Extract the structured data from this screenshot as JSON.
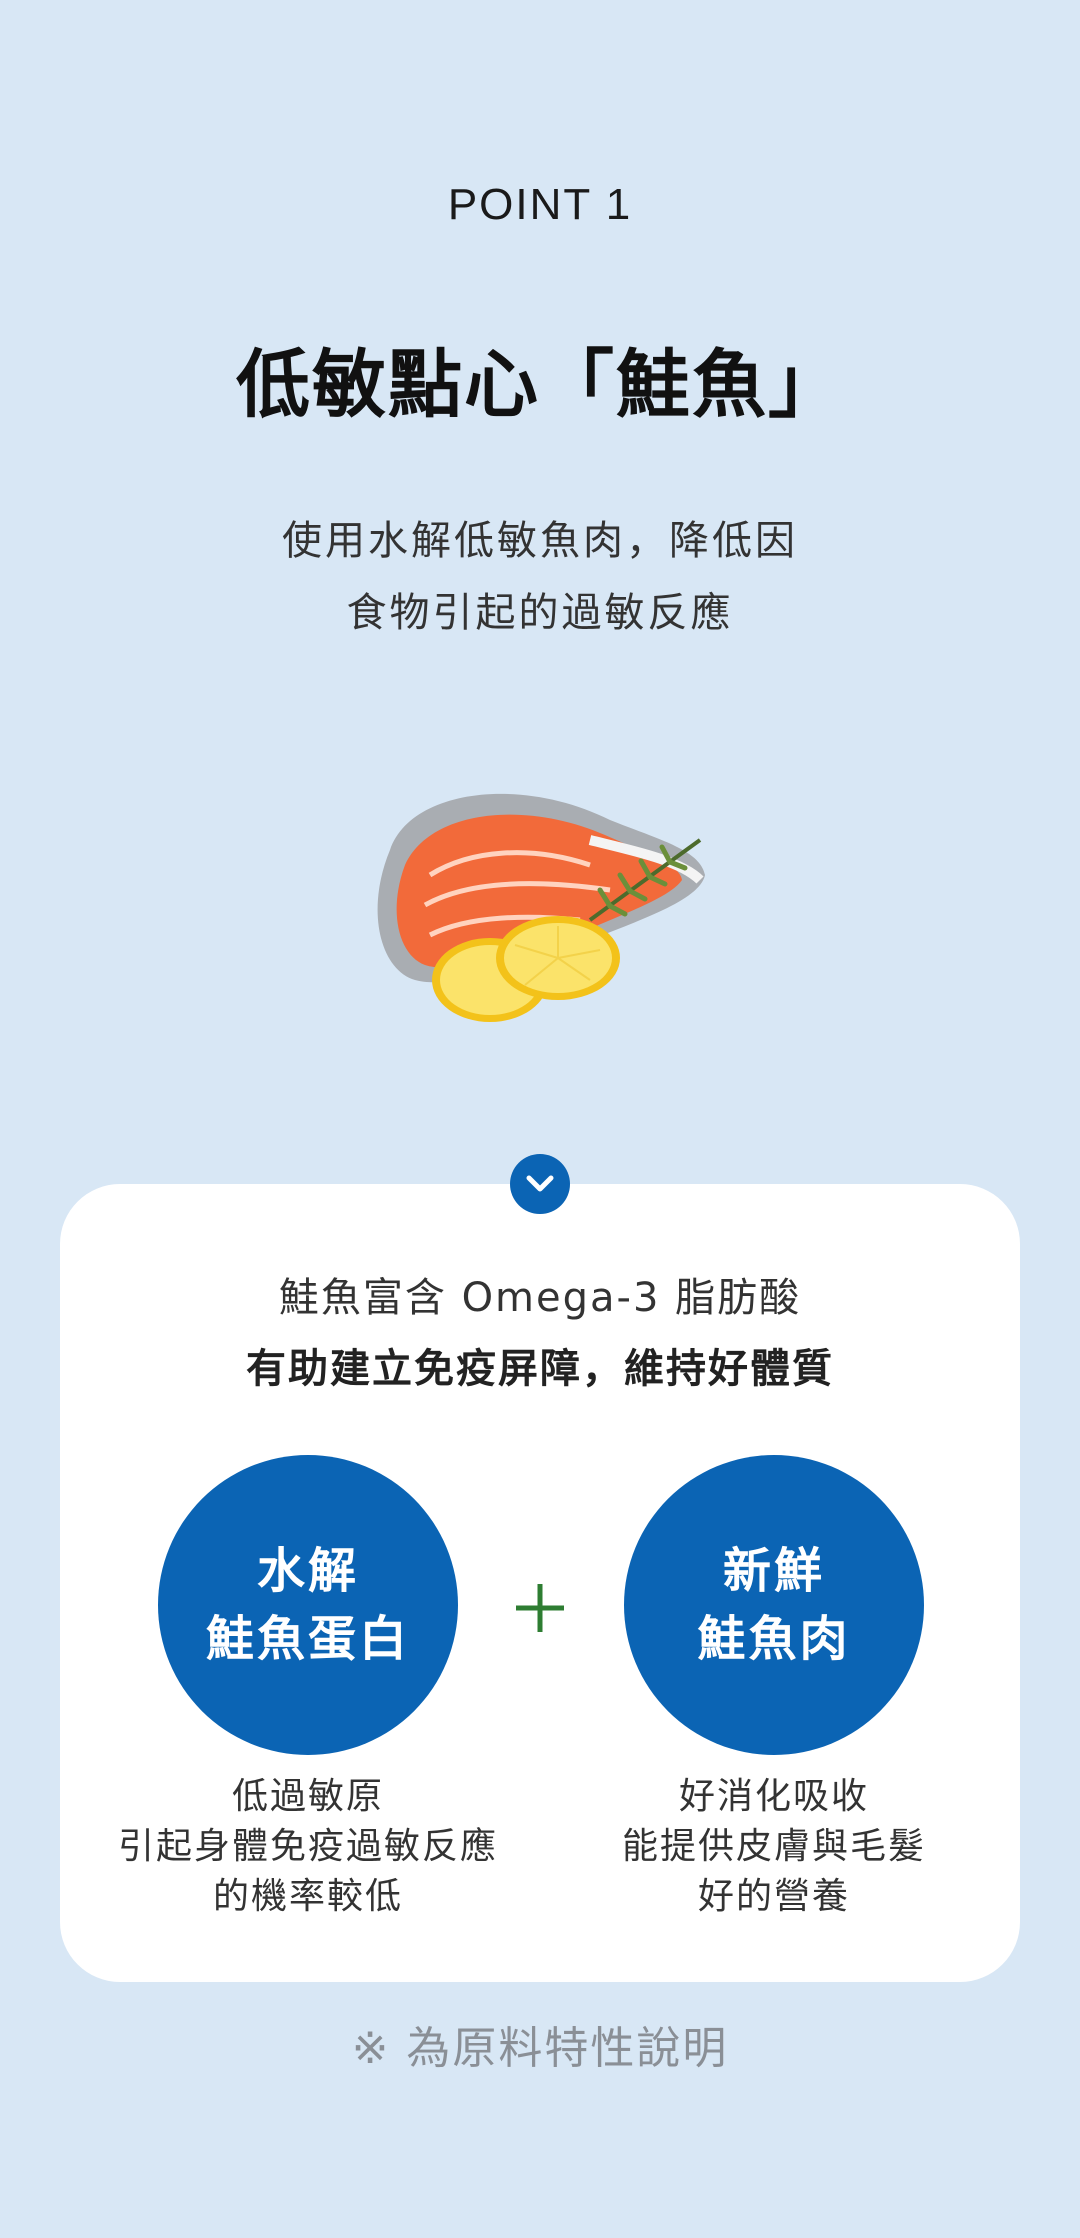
{
  "header": {
    "point_label": "POINT 1",
    "title": "低敏點心「鮭魚」",
    "subtitle_line1": "使用水解低敏魚肉，降低因",
    "subtitle_line2": "食物引起的過敏反應"
  },
  "illustration": {
    "icon": "salmon-steak-with-lemon"
  },
  "card": {
    "line1": "鮭魚富含 Omega-3 脂肪酸",
    "line2": "有助建立免疫屏障，維持好體質",
    "left": {
      "circle_line1": "水解",
      "circle_line2": "鮭魚蛋白",
      "desc_line1": "低過敏原",
      "desc_line2": "引起身體免疫過敏反應",
      "desc_line3": "的機率較低"
    },
    "right": {
      "circle_line1": "新鮮",
      "circle_line2": "鮭魚肉",
      "desc_line1": "好消化吸收",
      "desc_line2": "能提供皮膚與毛髮",
      "desc_line3": "好的營養"
    }
  },
  "footnote": "※ 為原料特性說明",
  "colors": {
    "background": "#d8e7f5",
    "accent_blue": "#0b64b4",
    "plus_green": "#2e7d32",
    "card": "#ffffff"
  }
}
